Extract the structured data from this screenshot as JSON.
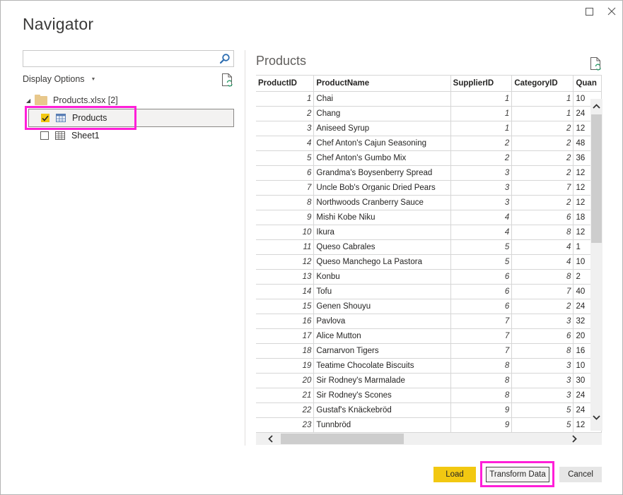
{
  "window": {
    "title": "Navigator",
    "maximize_label": "Maximize",
    "close_label": "Close"
  },
  "left_pane": {
    "search": {
      "value": "",
      "placeholder": ""
    },
    "display_options_label": "Display Options",
    "tree": {
      "root": {
        "label": "Products.xlsx [2]",
        "expanded": true,
        "icon": "folder-icon"
      },
      "items": [
        {
          "label": "Products",
          "checked": true,
          "selected": true,
          "icon": "table-icon",
          "highlighted": true
        },
        {
          "label": "Sheet1",
          "checked": false,
          "selected": false,
          "icon": "sheet-icon"
        }
      ]
    }
  },
  "preview": {
    "title": "Products",
    "columns": [
      "ProductID",
      "ProductName",
      "SupplierID",
      "CategoryID",
      "Quan"
    ],
    "rows": [
      [
        "1",
        "Chai",
        "1",
        "1",
        "10"
      ],
      [
        "2",
        "Chang",
        "1",
        "1",
        "24"
      ],
      [
        "3",
        "Aniseed Syrup",
        "1",
        "2",
        "12"
      ],
      [
        "4",
        "Chef Anton's Cajun Seasoning",
        "2",
        "2",
        "48"
      ],
      [
        "5",
        "Chef Anton's Gumbo Mix",
        "2",
        "2",
        "36"
      ],
      [
        "6",
        "Grandma's Boysenberry Spread",
        "3",
        "2",
        "12"
      ],
      [
        "7",
        "Uncle Bob's Organic Dried Pears",
        "3",
        "7",
        "12"
      ],
      [
        "8",
        "Northwoods Cranberry Sauce",
        "3",
        "2",
        "12"
      ],
      [
        "9",
        "Mishi Kobe Niku",
        "4",
        "6",
        "18"
      ],
      [
        "10",
        "Ikura",
        "4",
        "8",
        "12"
      ],
      [
        "11",
        "Queso Cabrales",
        "5",
        "4",
        "1"
      ],
      [
        "12",
        "Queso Manchego La Pastora",
        "5",
        "4",
        "10"
      ],
      [
        "13",
        "Konbu",
        "6",
        "8",
        "2"
      ],
      [
        "14",
        "Tofu",
        "6",
        "7",
        "40"
      ],
      [
        "15",
        "Genen Shouyu",
        "6",
        "2",
        "24"
      ],
      [
        "16",
        "Pavlova",
        "7",
        "3",
        "32"
      ],
      [
        "17",
        "Alice Mutton",
        "7",
        "6",
        "20"
      ],
      [
        "18",
        "Carnarvon Tigers",
        "7",
        "8",
        "16"
      ],
      [
        "19",
        "Teatime Chocolate Biscuits",
        "8",
        "3",
        "10"
      ],
      [
        "20",
        "Sir Rodney's Marmalade",
        "8",
        "3",
        "30"
      ],
      [
        "21",
        "Sir Rodney's Scones",
        "8",
        "3",
        "24"
      ],
      [
        "22",
        "Gustaf's Knäckebröd",
        "9",
        "5",
        "24"
      ],
      [
        "23",
        "Tunnbröd",
        "9",
        "5",
        "12"
      ]
    ]
  },
  "footer": {
    "load_label": "Load",
    "transform_label": "Transform Data",
    "cancel_label": "Cancel"
  },
  "colors": {
    "accent_yellow": "#f2c811",
    "highlight_magenta": "#ff1fd8"
  }
}
